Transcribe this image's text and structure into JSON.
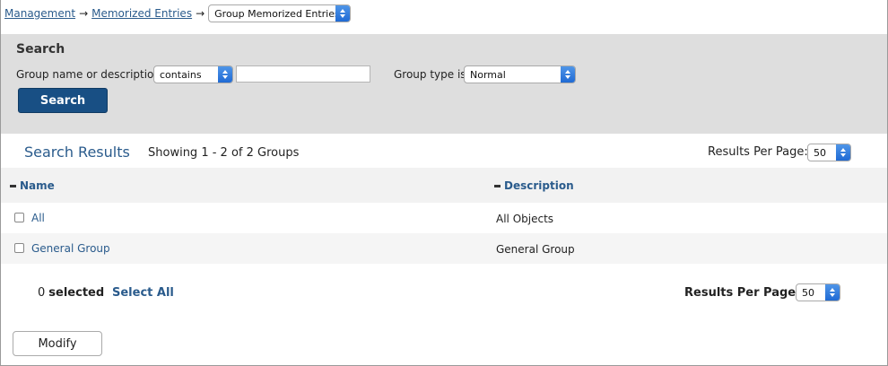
{
  "breadcrumb": {
    "items": [
      "Management",
      "Memorized Entries"
    ],
    "separator": "→",
    "current_select": "Group Memorized Entries"
  },
  "search": {
    "title": "Search",
    "name_label": "Group name or description",
    "match_mode": "contains",
    "query_value": "",
    "type_label": "Group type is",
    "type_value": "Normal",
    "button_label": "Search"
  },
  "results": {
    "title": "Search Results",
    "showing": "Showing 1 - 2 of 2 Groups",
    "per_page_label": "Results Per Page:",
    "per_page_value": "50",
    "columns": [
      "Name",
      "Description"
    ],
    "rows": [
      {
        "name": "All",
        "description": "All Objects"
      },
      {
        "name": "General Group",
        "description": "General Group"
      }
    ]
  },
  "footer": {
    "selected_count": "0",
    "selected_label": "selected",
    "select_all": "Select All",
    "per_page_label": "Results Per Page:",
    "per_page_value": "50",
    "modify_label": "Modify"
  },
  "colors": {
    "accent_link": "#2a5b8c",
    "primary_button": "#184f84",
    "panel_bg": "#dedede"
  }
}
